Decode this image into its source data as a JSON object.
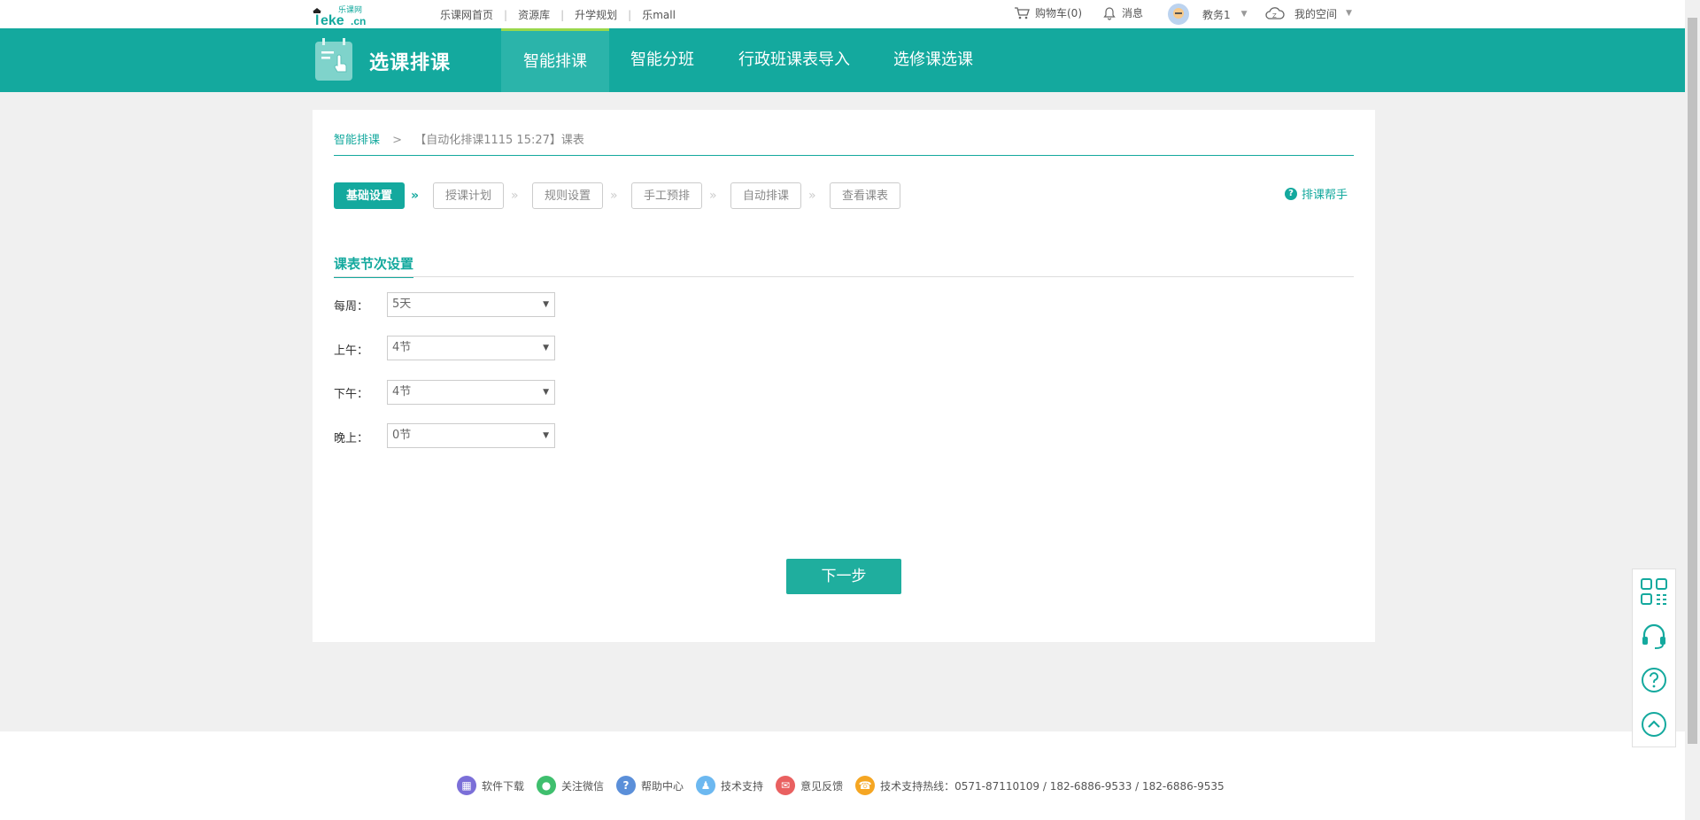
{
  "topbar": {
    "logo_text": "leke.cn",
    "logo_cn": "乐课网",
    "links": [
      "乐课网首页",
      "资源库",
      "升学规划",
      "乐mall"
    ],
    "cart": "购物车(0)",
    "messages": "消息",
    "user": "教务1",
    "space": "我的空间"
  },
  "banner": {
    "module_title": "选课排课",
    "tabs": [
      "智能排课",
      "智能分班",
      "行政班课表导入",
      "选修课选课"
    ],
    "active_tab": "智能排课"
  },
  "breadcrumb": {
    "root": "智能排课",
    "separator": ">",
    "current": "【自动化排课1115 15:27】课表"
  },
  "steps": [
    "基础设置",
    "授课计划",
    "规则设置",
    "手工预排",
    "自动排课",
    "查看课表"
  ],
  "help_label": "排课帮手",
  "section": {
    "title": "课表节次设置",
    "fields": [
      {
        "label": "每周：",
        "value": "5天"
      },
      {
        "label": "上午：",
        "value": "4节"
      },
      {
        "label": "下午：",
        "value": "4节"
      },
      {
        "label": "晚上：",
        "value": "0节"
      }
    ]
  },
  "next_button": "下一步",
  "footer": [
    {
      "label": "软件下载",
      "icon": "apps-icon",
      "color": "#7b6fd8"
    },
    {
      "label": "关注微信",
      "icon": "wechat-icon",
      "color": "#3fbf6e"
    },
    {
      "label": "帮助中心",
      "icon": "help-icon",
      "color": "#5b8fd9"
    },
    {
      "label": "技术支持",
      "icon": "support-icon",
      "color": "#6cb8f0"
    },
    {
      "label": "意见反馈",
      "icon": "feedback-icon",
      "color": "#e96060"
    },
    {
      "label": "技术支持热线：0571-87110109 / 182-6886-9533 / 182-6886-9535",
      "icon": "hotline-icon",
      "color": "#f5a623"
    }
  ],
  "colors": {
    "primary": "#14a99e",
    "button": "#1fae9e",
    "active_tab_border": "#9ad84c"
  }
}
